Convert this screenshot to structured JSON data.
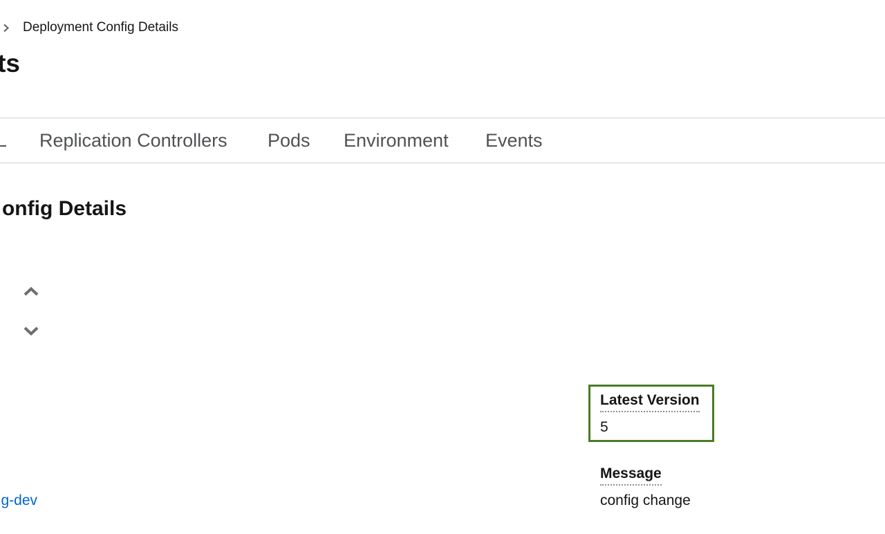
{
  "breadcrumb": {
    "current": "Deployment Config Details"
  },
  "page": {
    "title_visible": "ts"
  },
  "tabs": [
    {
      "label": "Replication Controllers"
    },
    {
      "label": "Pods"
    },
    {
      "label": "Environment"
    },
    {
      "label": "Events"
    }
  ],
  "section": {
    "title_visible": "onfig Details"
  },
  "details": {
    "latest_version_label": "Latest Version",
    "latest_version_value": "5",
    "message_label": "Message",
    "message_value": "config change"
  },
  "left_column": {
    "link_visible": "g-dev"
  },
  "colors": {
    "highlight_border": "#4a7b26",
    "link": "#0066cc",
    "tab_text": "#4f5255"
  },
  "icons": {
    "breadcrumb_separator": "chevron-right-icon",
    "sort_up": "chevron-up-icon",
    "sort_down": "chevron-down-icon"
  }
}
